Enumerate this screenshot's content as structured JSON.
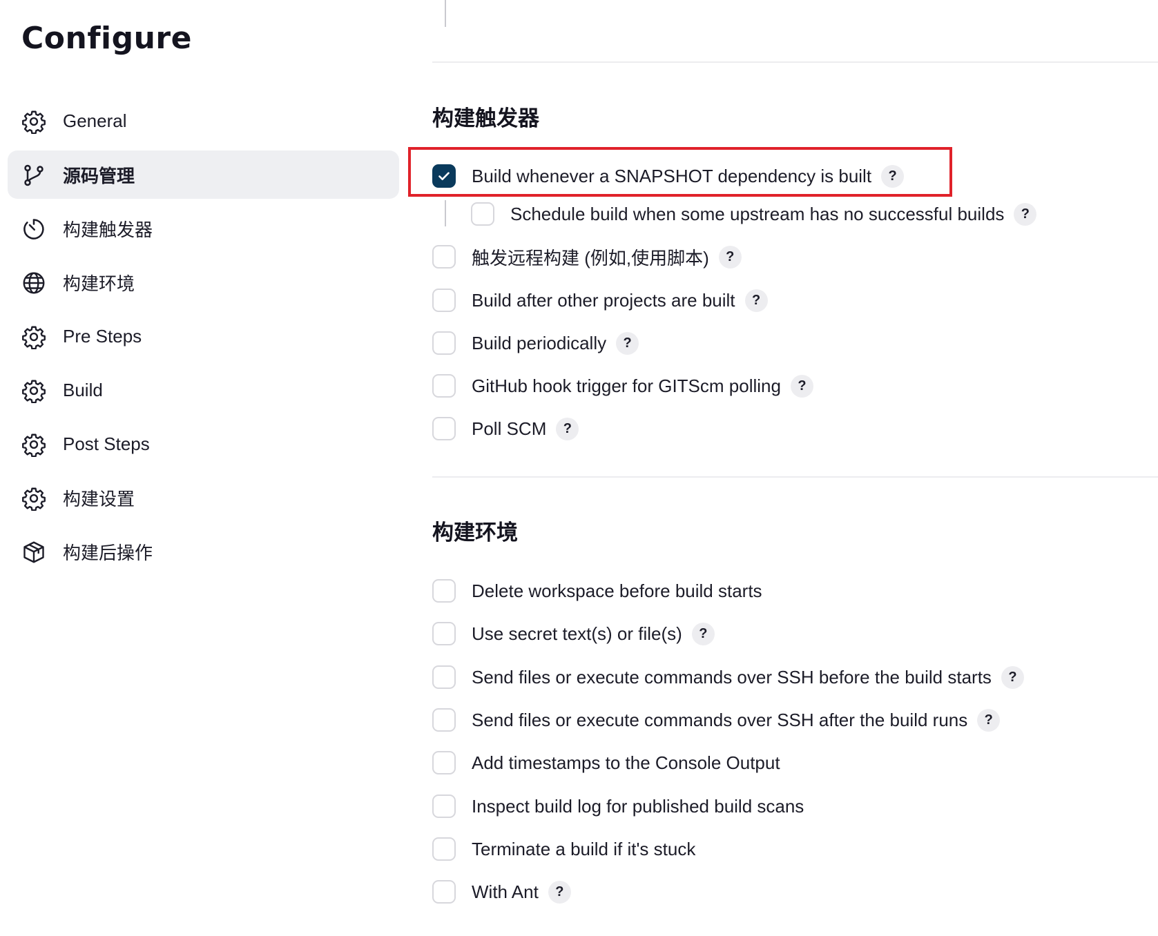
{
  "page": {
    "title": "Configure"
  },
  "sidebar": {
    "items": [
      {
        "label": "General",
        "icon": "gear-icon",
        "active": false
      },
      {
        "label": "源码管理",
        "icon": "git-branch-icon",
        "active": true
      },
      {
        "label": "构建触发器",
        "icon": "timer-icon",
        "active": false
      },
      {
        "label": "构建环境",
        "icon": "globe-icon",
        "active": false
      },
      {
        "label": "Pre Steps",
        "icon": "gear-icon",
        "active": false
      },
      {
        "label": "Build",
        "icon": "gear-icon",
        "active": false
      },
      {
        "label": "Post Steps",
        "icon": "gear-icon",
        "active": false
      },
      {
        "label": "构建设置",
        "icon": "gear-icon",
        "active": false
      },
      {
        "label": "构建后操作",
        "icon": "package-icon",
        "active": false
      }
    ]
  },
  "help_label": "?",
  "triggers": {
    "title": "构建触发器",
    "options": [
      {
        "label": "Build whenever a SNAPSHOT dependency is built",
        "checked": true,
        "help": true,
        "highlighted": true
      },
      {
        "label": "Schedule build when some upstream has no successful builds",
        "checked": false,
        "help": true,
        "nested": true
      },
      {
        "label": "触发远程构建 (例如,使用脚本)",
        "checked": false,
        "help": true
      },
      {
        "label": "Build after other projects are built",
        "checked": false,
        "help": true
      },
      {
        "label": "Build periodically",
        "checked": false,
        "help": true
      },
      {
        "label": "GitHub hook trigger for GITScm polling",
        "checked": false,
        "help": true
      },
      {
        "label": "Poll SCM",
        "checked": false,
        "help": true
      }
    ]
  },
  "environment": {
    "title": "构建环境",
    "options": [
      {
        "label": "Delete workspace before build starts",
        "checked": false,
        "help": false
      },
      {
        "label": "Use secret text(s) or file(s)",
        "checked": false,
        "help": true
      },
      {
        "label": "Send files or execute commands over SSH before the build starts",
        "checked": false,
        "help": true
      },
      {
        "label": "Send files or execute commands over SSH after the build runs",
        "checked": false,
        "help": true
      },
      {
        "label": "Add timestamps to the Console Output",
        "checked": false,
        "help": false
      },
      {
        "label": "Inspect build log for published build scans",
        "checked": false,
        "help": false
      },
      {
        "label": "Terminate a build if it's stuck",
        "checked": false,
        "help": false
      },
      {
        "label": "With Ant",
        "checked": false,
        "help": true
      }
    ]
  },
  "colors": {
    "checked": "#0a3a5c",
    "highlight": "#e0222a",
    "active_nav": "#eeeff2"
  }
}
